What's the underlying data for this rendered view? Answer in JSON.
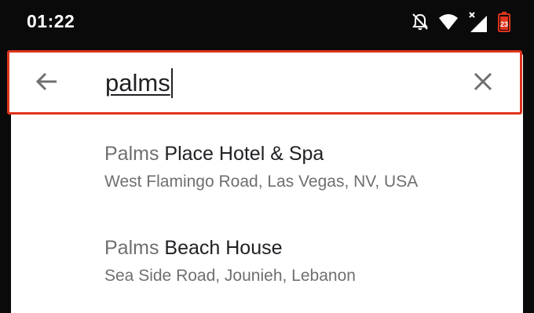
{
  "status_bar": {
    "time": "01:22",
    "icons": [
      "notifications-off-icon",
      "wifi-icon",
      "cellular-no-data-icon",
      "battery-low-icon"
    ],
    "battery_color": "#e0341c"
  },
  "search": {
    "query": "palms",
    "back_icon": "arrow-back-icon",
    "clear_icon": "close-icon",
    "highlight_color": "#e0341c"
  },
  "results": [
    {
      "match": "Palms",
      "rest": "Place Hotel & Spa",
      "address": "West Flamingo Road, Las Vegas, NV, USA"
    },
    {
      "match": "Palms",
      "rest": "Beach House",
      "address": "Sea Side Road, Jounieh, Lebanon"
    }
  ]
}
